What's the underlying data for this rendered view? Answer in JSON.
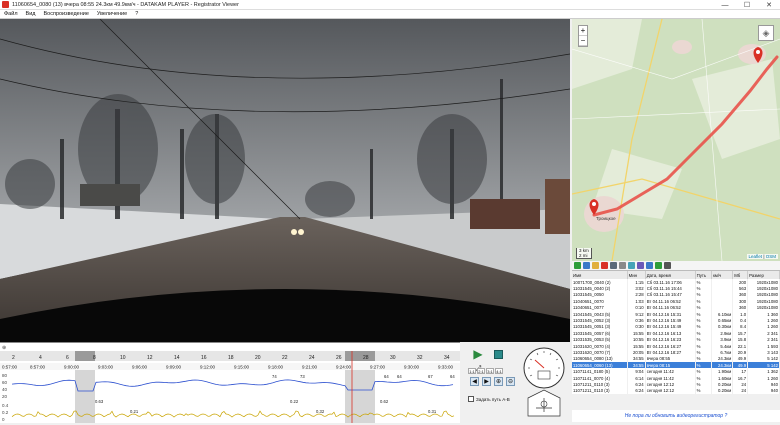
{
  "titlebar": {
    "title": "11060654_0080 (13)   вчера 08:55   24.3км   49.9км/ч  -  DATAKAM PLAYER - Registrator Viewer"
  },
  "menu": [
    "Файл",
    "Вид",
    "Воспроизведение",
    "Увеличение",
    "?"
  ],
  "map": {
    "zoom_in": "+",
    "zoom_out": "−",
    "scale_km": "3 km",
    "scale_mi": "2 mi",
    "attribution_leaflet": "Leaflet",
    "attribution_osm": "OSM",
    "town_label": "Троицкое",
    "route_color": "#e8534a",
    "marker_color": "#d93025"
  },
  "file_table": {
    "headers": [
      "Имя",
      "Мин",
      "Дата, время",
      "Путь",
      "км/ч",
      "Мб",
      "Размер"
    ],
    "rows": [
      [
        "10071700_0040 (2)",
        "1:15",
        "Сб 03.11.16 17:06",
        "%",
        "",
        "200",
        "1920x1080"
      ],
      [
        "11031545_0040 (2)",
        "3:02",
        "Сб 03.11.16 15:44",
        "%",
        "",
        "563",
        "1920x1080"
      ],
      [
        "11031545_0050",
        "2:28",
        "Сб 03.11.16 15:47",
        "%",
        "",
        "360",
        "1920x1080"
      ],
      [
        "11040651_0070",
        "1:03",
        "Вт 04.11.16 06:52",
        "%",
        "",
        "300",
        "1920x1080"
      ],
      [
        "11040651_0077",
        "0:10",
        "Вт 04.11.16 06:52",
        "%",
        "",
        "360",
        "1920x1080"
      ],
      [
        "11041545_0043 (5)",
        "9:12",
        "Вт 04.12.16 15:31",
        "%",
        "6.10км",
        "1.0",
        "1 360"
      ],
      [
        "11031545_0052 (3)",
        "0:36",
        "Вт 04.12.16 15:49",
        "%",
        "0.65км",
        "0.4",
        "1 260"
      ],
      [
        "11031545_0051 (3)",
        "0:30",
        "Вт 04.12.16 15:49",
        "%",
        "0.30км",
        "8.4",
        "1 260"
      ],
      [
        "11031545_0057 (6)",
        "15:55",
        "Вт 04.12.16 16:13",
        "%",
        "2.9км",
        "15.7",
        "2 341"
      ],
      [
        "11031535_0053 (5)",
        "10:55",
        "Вт 04.12.16 16:23",
        "%",
        "3.9км",
        "15.8",
        "2 341"
      ],
      [
        "11031620_0070 (4)",
        "15:55",
        "Вт 04.12.16 16:27",
        "%",
        "5.4км",
        "22.1",
        "1 593"
      ],
      [
        "11031620_0070 (7)",
        "20:05",
        "Вт 04.12.16 18:27",
        "%",
        "6.7км",
        "20.9",
        "3 143"
      ],
      [
        "11060654_0080 (13)",
        "34:55",
        "вчера 08:55",
        "%",
        "24.3км",
        "49.9",
        "5 142"
      ],
      [
        "11060654_0060 (13)",
        "34:55",
        "вчера 08:15",
        "%",
        "24.3км",
        "49.9",
        "5 142"
      ],
      [
        "11071141_0180 (5)",
        "9:04",
        "сегодня 11:42",
        "%",
        "1.90км",
        "17",
        "1 362"
      ],
      [
        "11071141_0070 (4)",
        "6:14",
        "сегодня 11:42",
        "%",
        "1.60км",
        "16.7",
        "1 260"
      ],
      [
        "11071211_0110 (3)",
        "6:24",
        "сегодня 12:12",
        "%",
        "0.20км",
        "24",
        "940"
      ],
      [
        "11071211_0110 (3)",
        "6:24",
        "сегодня 12:12",
        "%",
        "0.20км",
        "24",
        "940"
      ]
    ],
    "row_sizes": [
      "1920x1080",
      "1920x1080",
      "1920x1080",
      "1920x1080",
      "1920x1080",
      "1920x1080",
      "1920x1080",
      "1920x1080",
      "1920x1080",
      "1920x1080",
      "1920x1080",
      "1920x1080",
      "1920x1080",
      "1920x1080",
      "1920x1080",
      "1920x1080",
      "1920x1080",
      "1920x1080"
    ],
    "selected_index": 13
  },
  "status_link": "Не пора ли обновить видеорегистратор ?",
  "timeline": {
    "ruler_labels": [
      "2",
      "4",
      "6",
      "8",
      "10",
      "12",
      "14",
      "16",
      "18",
      "20",
      "22",
      "24",
      "26",
      "28",
      "30",
      "32",
      "34"
    ],
    "time_labels": [
      "8:57:00",
      "9:00:00",
      "9:03:00",
      "9:06:00",
      "9:09:00",
      "9:12:00",
      "9:15:00",
      "9:18:00",
      "9:21:00",
      "9:24:00",
      "9:27:00",
      "9:30:00",
      "9:33:00"
    ],
    "left_time": "0:57:00",
    "speed_axis": [
      "80",
      "60",
      "40",
      "20"
    ],
    "accel_axis": [
      "0.4",
      "0.2",
      "0"
    ],
    "speed_marks": [
      "74",
      "73",
      "64",
      "64",
      "67",
      "64"
    ],
    "accel_marks": [
      "0.63",
      "0.21",
      "0.22",
      "0.32",
      "0.62",
      "0.31"
    ],
    "speed_color": "#2b4fcf",
    "accel_color": "#c9a400"
  },
  "controls": {
    "ab_checkbox_label": "Задать путь А-В",
    "zoom_labels": [
      "1:1",
      "2:1",
      "3:1",
      "4:1"
    ]
  }
}
